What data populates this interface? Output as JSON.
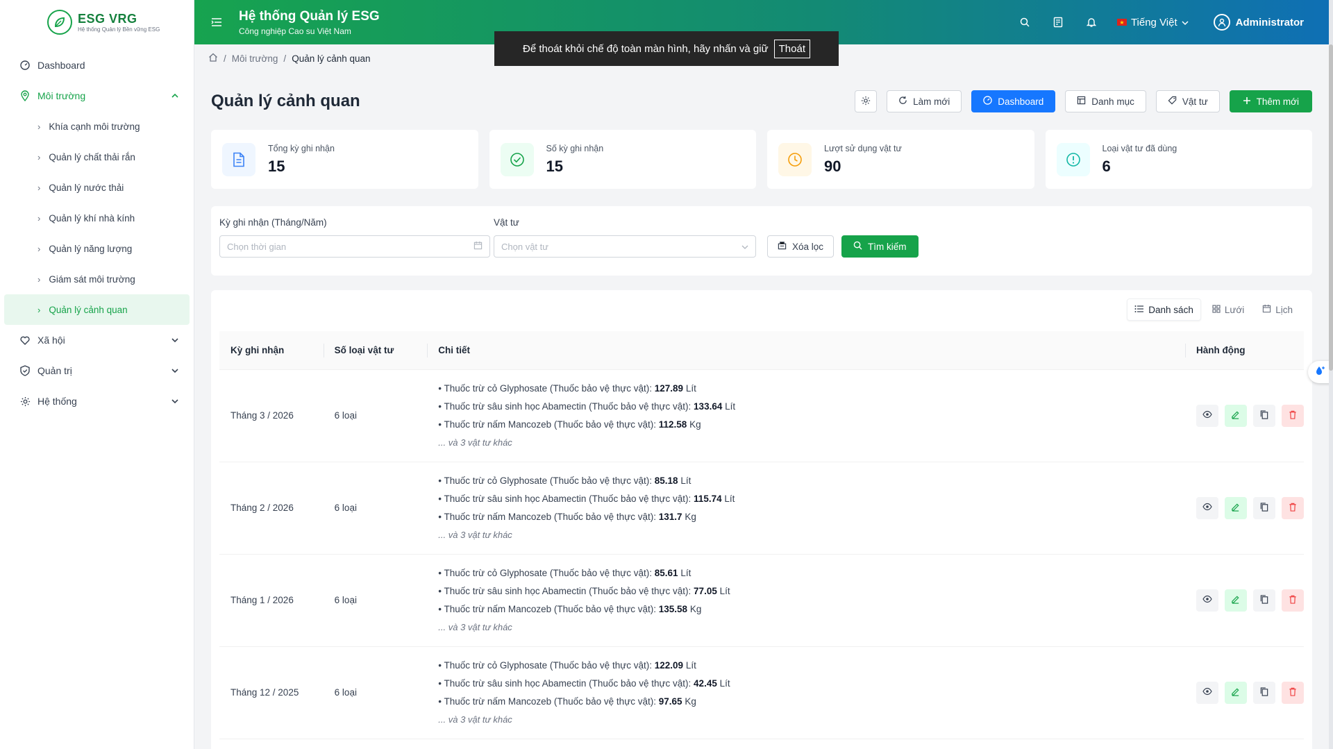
{
  "brand": {
    "name": "ESG VRG",
    "tagline": "Hệ thống Quản lý Bền vững ESG"
  },
  "sidebar": {
    "items": [
      {
        "label": "Dashboard",
        "icon": "dashboard-icon"
      },
      {
        "label": "Môi trường",
        "icon": "location-icon",
        "open": true
      },
      {
        "label": "Xã hội",
        "icon": "heart-icon"
      },
      {
        "label": "Quản trị",
        "icon": "shield-icon"
      },
      {
        "label": "Hệ thống",
        "icon": "gear-icon"
      }
    ],
    "subitems": [
      {
        "label": "Khía cạnh môi trường"
      },
      {
        "label": "Quản lý chất thải rắn"
      },
      {
        "label": "Quản lý nước thải"
      },
      {
        "label": "Quản lý khí nhà kính"
      },
      {
        "label": "Quản lý năng lượng"
      },
      {
        "label": "Giám sát môi trường"
      },
      {
        "label": "Quản lý cảnh quan",
        "active": true
      }
    ]
  },
  "header": {
    "title": "Hệ thống Quản lý ESG",
    "subtitle": "Công nghiệp Cao su Việt Nam",
    "language": "Tiếng Việt",
    "user": "Administrator"
  },
  "toast": {
    "text": "Để thoát khỏi chế độ toàn màn hình, hãy nhấn và giữ",
    "button": "Thoát"
  },
  "breadcrumb": {
    "parent": "Môi trường",
    "current": "Quản lý cảnh quan"
  },
  "page": {
    "title": "Quản lý cảnh quan"
  },
  "toolbar": {
    "refresh": "Làm mới",
    "dashboard": "Dashboard",
    "catalog": "Danh mục",
    "materials": "Vật tư",
    "add_new": "Thêm mới"
  },
  "stats": [
    {
      "label": "Tổng kỳ ghi nhận",
      "value": "15",
      "color": "#3b82f6",
      "bg": "#eff6ff",
      "icon": "document-icon"
    },
    {
      "label": "Số kỳ ghi nhận",
      "value": "15",
      "color": "#16a34a",
      "bg": "#ecfdf3",
      "icon": "check-circle-icon"
    },
    {
      "label": "Lượt sử dụng vật tư",
      "value": "90",
      "color": "#f59e0b",
      "bg": "#fff7e6",
      "icon": "clock-icon"
    },
    {
      "label": "Loại vật tư đã dùng",
      "value": "6",
      "color": "#14b8a6",
      "bg": "#ecfeff",
      "icon": "alert-circle-icon"
    }
  ],
  "filter": {
    "period_label": "Kỳ ghi nhận (Tháng/Năm)",
    "period_placeholder": "Chọn thời gian",
    "material_label": "Vật tư",
    "material_placeholder": "Chọn vật tư",
    "clear": "Xóa lọc",
    "search": "Tìm kiếm"
  },
  "views": {
    "list": "Danh sách",
    "grid": "Lưới",
    "calendar": "Lịch"
  },
  "table": {
    "headers": [
      "Kỳ ghi nhận",
      "Số loại vật tư",
      "Chi tiết",
      "Hành động"
    ],
    "rows": [
      {
        "period": "Tháng 3 / 2026",
        "count": "6 loại",
        "details": [
          {
            "name": "Thuốc trừ cỏ Glyphosate (Thuốc bảo vệ thực vật):",
            "qty": "127.89",
            "unit": "Lít"
          },
          {
            "name": "Thuốc trừ sâu sinh học Abamectin (Thuốc bảo vệ thực vật):",
            "qty": "133.64",
            "unit": "Lít"
          },
          {
            "name": "Thuốc trừ nấm Mancozeb (Thuốc bảo vệ thực vật):",
            "qty": "112.58",
            "unit": "Kg"
          }
        ],
        "more": "... và 3 vật tư khác"
      },
      {
        "period": "Tháng 2 / 2026",
        "count": "6 loại",
        "details": [
          {
            "name": "Thuốc trừ cỏ Glyphosate (Thuốc bảo vệ thực vật):",
            "qty": "85.18",
            "unit": "Lít"
          },
          {
            "name": "Thuốc trừ sâu sinh học Abamectin (Thuốc bảo vệ thực vật):",
            "qty": "115.74",
            "unit": "Lít"
          },
          {
            "name": "Thuốc trừ nấm Mancozeb (Thuốc bảo vệ thực vật):",
            "qty": "131.7",
            "unit": "Kg"
          }
        ],
        "more": "... và 3 vật tư khác"
      },
      {
        "period": "Tháng 1 / 2026",
        "count": "6 loại",
        "details": [
          {
            "name": "Thuốc trừ cỏ Glyphosate (Thuốc bảo vệ thực vật):",
            "qty": "85.61",
            "unit": "Lít"
          },
          {
            "name": "Thuốc trừ sâu sinh học Abamectin (Thuốc bảo vệ thực vật):",
            "qty": "77.05",
            "unit": "Lít"
          },
          {
            "name": "Thuốc trừ nấm Mancozeb (Thuốc bảo vệ thực vật):",
            "qty": "135.58",
            "unit": "Kg"
          }
        ],
        "more": "... và 3 vật tư khác"
      },
      {
        "period": "Tháng 12 / 2025",
        "count": "6 loại",
        "details": [
          {
            "name": "Thuốc trừ cỏ Glyphosate (Thuốc bảo vệ thực vật):",
            "qty": "122.09",
            "unit": "Lít"
          },
          {
            "name": "Thuốc trừ sâu sinh học Abamectin (Thuốc bảo vệ thực vật):",
            "qty": "42.45",
            "unit": "Lít"
          },
          {
            "name": "Thuốc trừ nấm Mancozeb (Thuốc bảo vệ thực vật):",
            "qty": "97.65",
            "unit": "Kg"
          }
        ],
        "more": "... và 3 vật tư khác"
      }
    ]
  },
  "colors": {
    "primary_green": "#16a34a",
    "primary_blue": "#1677ff",
    "danger": "#ef4444"
  }
}
